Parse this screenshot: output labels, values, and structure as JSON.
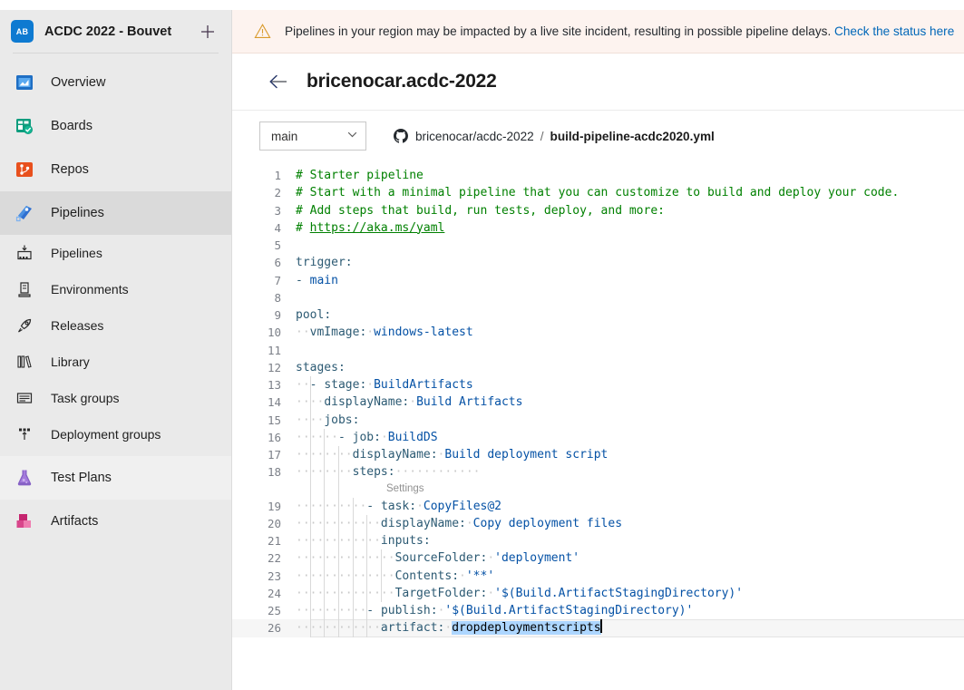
{
  "sidebar": {
    "project": {
      "avatar_initials": "AB",
      "name": "ACDC 2022 - Bouvet",
      "add_icon": "plus-icon"
    },
    "items": [
      {
        "label": "Overview",
        "icon": "overview-icon",
        "level": "top",
        "state": "normal"
      },
      {
        "label": "Boards",
        "icon": "boards-icon",
        "level": "top",
        "state": "normal"
      },
      {
        "label": "Repos",
        "icon": "repos-icon",
        "level": "top",
        "state": "normal"
      },
      {
        "label": "Pipelines",
        "icon": "pipelines-icon",
        "level": "top",
        "state": "selected"
      },
      {
        "label": "Pipelines",
        "icon": "pipelines-sub-icon",
        "level": "sub",
        "state": "normal"
      },
      {
        "label": "Environments",
        "icon": "environments-icon",
        "level": "sub",
        "state": "normal"
      },
      {
        "label": "Releases",
        "icon": "releases-icon",
        "level": "sub",
        "state": "normal"
      },
      {
        "label": "Library",
        "icon": "library-icon",
        "level": "sub",
        "state": "normal"
      },
      {
        "label": "Task groups",
        "icon": "task-groups-icon",
        "level": "sub",
        "state": "normal"
      },
      {
        "label": "Deployment groups",
        "icon": "deployment-groups-icon",
        "level": "sub",
        "state": "normal"
      },
      {
        "label": "Test Plans",
        "icon": "test-plans-icon",
        "level": "top",
        "state": "hover"
      },
      {
        "label": "Artifacts",
        "icon": "artifacts-icon",
        "level": "top",
        "state": "normal"
      }
    ]
  },
  "banner": {
    "icon": "warning-triangle-icon",
    "message": "Pipelines in your region may be impacted by a live site incident, resulting in possible pipeline delays.",
    "link_text": "Check the status here"
  },
  "page": {
    "back_icon": "back-arrow-icon",
    "title": "bricenocar.acdc-2022"
  },
  "toolbar": {
    "branch": "main",
    "branch_chevron": "chevron-down-icon",
    "repo_icon": "github-icon",
    "repo": "bricenocar/acdc-2022",
    "separator": "/",
    "file": "build-pipeline-acdc2020.yml"
  },
  "editor": {
    "codelens_label": "Settings",
    "codelens_after_line": 18,
    "current_line": 26,
    "selection_line": 26,
    "selection_text": "dropdeploymentscripts",
    "lines": [
      {
        "n": 1,
        "tokens": [
          {
            "t": "comment",
            "v": "# Starter pipeline"
          }
        ]
      },
      {
        "n": 2,
        "tokens": [
          {
            "t": "comment",
            "v": "# Start with a minimal pipeline that you can customize to build and deploy your code."
          }
        ]
      },
      {
        "n": 3,
        "tokens": [
          {
            "t": "comment",
            "v": "# Add steps that build, run tests, deploy, and more:"
          }
        ]
      },
      {
        "n": 4,
        "tokens": [
          {
            "t": "comment",
            "v": "# "
          },
          {
            "t": "link",
            "v": "https://aka.ms/yaml"
          }
        ]
      },
      {
        "n": 5,
        "tokens": []
      },
      {
        "n": 6,
        "tokens": [
          {
            "t": "key",
            "v": "trigger"
          },
          {
            "t": "punct",
            "v": ":"
          }
        ]
      },
      {
        "n": 7,
        "tokens": [
          {
            "t": "dash",
            "v": "- "
          },
          {
            "t": "val",
            "v": "main"
          }
        ]
      },
      {
        "n": 8,
        "tokens": []
      },
      {
        "n": 9,
        "tokens": [
          {
            "t": "key",
            "v": "pool"
          },
          {
            "t": "punct",
            "v": ":"
          }
        ]
      },
      {
        "n": 10,
        "tokens": [
          {
            "t": "ws",
            "v": "··"
          },
          {
            "t": "key",
            "v": "vmImage"
          },
          {
            "t": "punct",
            "v": ":"
          },
          {
            "t": "ws",
            "v": "·"
          },
          {
            "t": "val",
            "v": "windows-latest"
          }
        ]
      },
      {
        "n": 11,
        "tokens": []
      },
      {
        "n": 12,
        "tokens": [
          {
            "t": "key",
            "v": "stages"
          },
          {
            "t": "punct",
            "v": ":"
          }
        ]
      },
      {
        "n": 13,
        "tokens": [
          {
            "t": "ws",
            "v": "··"
          },
          {
            "t": "dash",
            "v": "- "
          },
          {
            "t": "key",
            "v": "stage"
          },
          {
            "t": "punct",
            "v": ":"
          },
          {
            "t": "ws",
            "v": "·"
          },
          {
            "t": "val",
            "v": "BuildArtifacts"
          }
        ]
      },
      {
        "n": 14,
        "tokens": [
          {
            "t": "ws",
            "v": "····"
          },
          {
            "t": "key",
            "v": "displayName"
          },
          {
            "t": "punct",
            "v": ":"
          },
          {
            "t": "ws",
            "v": "·"
          },
          {
            "t": "val",
            "v": "Build Artifacts"
          }
        ]
      },
      {
        "n": 15,
        "tokens": [
          {
            "t": "ws",
            "v": "····"
          },
          {
            "t": "key",
            "v": "jobs"
          },
          {
            "t": "punct",
            "v": ":"
          }
        ]
      },
      {
        "n": 16,
        "tokens": [
          {
            "t": "ws",
            "v": "······"
          },
          {
            "t": "dash",
            "v": "- "
          },
          {
            "t": "key",
            "v": "job"
          },
          {
            "t": "punct",
            "v": ":"
          },
          {
            "t": "ws",
            "v": "·"
          },
          {
            "t": "val",
            "v": "BuildDS"
          }
        ]
      },
      {
        "n": 17,
        "tokens": [
          {
            "t": "ws",
            "v": "········"
          },
          {
            "t": "key",
            "v": "displayName"
          },
          {
            "t": "punct",
            "v": ":"
          },
          {
            "t": "ws",
            "v": "·"
          },
          {
            "t": "val",
            "v": "Build deployment script"
          }
        ]
      },
      {
        "n": 18,
        "tokens": [
          {
            "t": "ws",
            "v": "········"
          },
          {
            "t": "key",
            "v": "steps"
          },
          {
            "t": "punct",
            "v": ":"
          },
          {
            "t": "ws",
            "v": "············"
          }
        ]
      },
      {
        "n": 19,
        "tokens": [
          {
            "t": "ws",
            "v": "··········"
          },
          {
            "t": "dash",
            "v": "- "
          },
          {
            "t": "key",
            "v": "task"
          },
          {
            "t": "punct",
            "v": ":"
          },
          {
            "t": "ws",
            "v": "·"
          },
          {
            "t": "val",
            "v": "CopyFiles@2"
          }
        ]
      },
      {
        "n": 20,
        "tokens": [
          {
            "t": "ws",
            "v": "············"
          },
          {
            "t": "key",
            "v": "displayName"
          },
          {
            "t": "punct",
            "v": ":"
          },
          {
            "t": "ws",
            "v": "·"
          },
          {
            "t": "val",
            "v": "Copy deployment files"
          }
        ]
      },
      {
        "n": 21,
        "tokens": [
          {
            "t": "ws",
            "v": "············"
          },
          {
            "t": "key",
            "v": "inputs"
          },
          {
            "t": "punct",
            "v": ":"
          }
        ]
      },
      {
        "n": 22,
        "tokens": [
          {
            "t": "ws",
            "v": "··············"
          },
          {
            "t": "key",
            "v": "SourceFolder"
          },
          {
            "t": "punct",
            "v": ":"
          },
          {
            "t": "ws",
            "v": "·"
          },
          {
            "t": "str",
            "v": "'deployment'"
          }
        ]
      },
      {
        "n": 23,
        "tokens": [
          {
            "t": "ws",
            "v": "··············"
          },
          {
            "t": "key",
            "v": "Contents"
          },
          {
            "t": "punct",
            "v": ":"
          },
          {
            "t": "ws",
            "v": "·"
          },
          {
            "t": "str",
            "v": "'**'"
          }
        ]
      },
      {
        "n": 24,
        "tokens": [
          {
            "t": "ws",
            "v": "··············"
          },
          {
            "t": "key",
            "v": "TargetFolder"
          },
          {
            "t": "punct",
            "v": ":"
          },
          {
            "t": "ws",
            "v": "·"
          },
          {
            "t": "str",
            "v": "'$(Build.ArtifactStagingDirectory)'"
          }
        ]
      },
      {
        "n": 25,
        "tokens": [
          {
            "t": "ws",
            "v": "··········"
          },
          {
            "t": "dash",
            "v": "- "
          },
          {
            "t": "key",
            "v": "publish"
          },
          {
            "t": "punct",
            "v": ":"
          },
          {
            "t": "ws",
            "v": "·"
          },
          {
            "t": "str",
            "v": "'$(Build.ArtifactStagingDirectory)'"
          }
        ]
      },
      {
        "n": 26,
        "tokens": [
          {
            "t": "ws",
            "v": "············"
          },
          {
            "t": "key",
            "v": "artifact"
          },
          {
            "t": "punct",
            "v": ":"
          },
          {
            "t": "ws",
            "v": "·"
          },
          {
            "t": "sel",
            "v": "dropdeploymentscripts"
          },
          {
            "t": "cursor",
            "v": ""
          }
        ]
      }
    ]
  },
  "colors": {
    "accent": "#0067b8",
    "banner_bg": "#fdf3ef",
    "warning": "#d99a2b",
    "sidebar_bg": "#eaeaea",
    "selection": "#add6ff",
    "comment": "#008000",
    "yaml_key": "#2c5a73",
    "yaml_value": "#0451a5"
  }
}
